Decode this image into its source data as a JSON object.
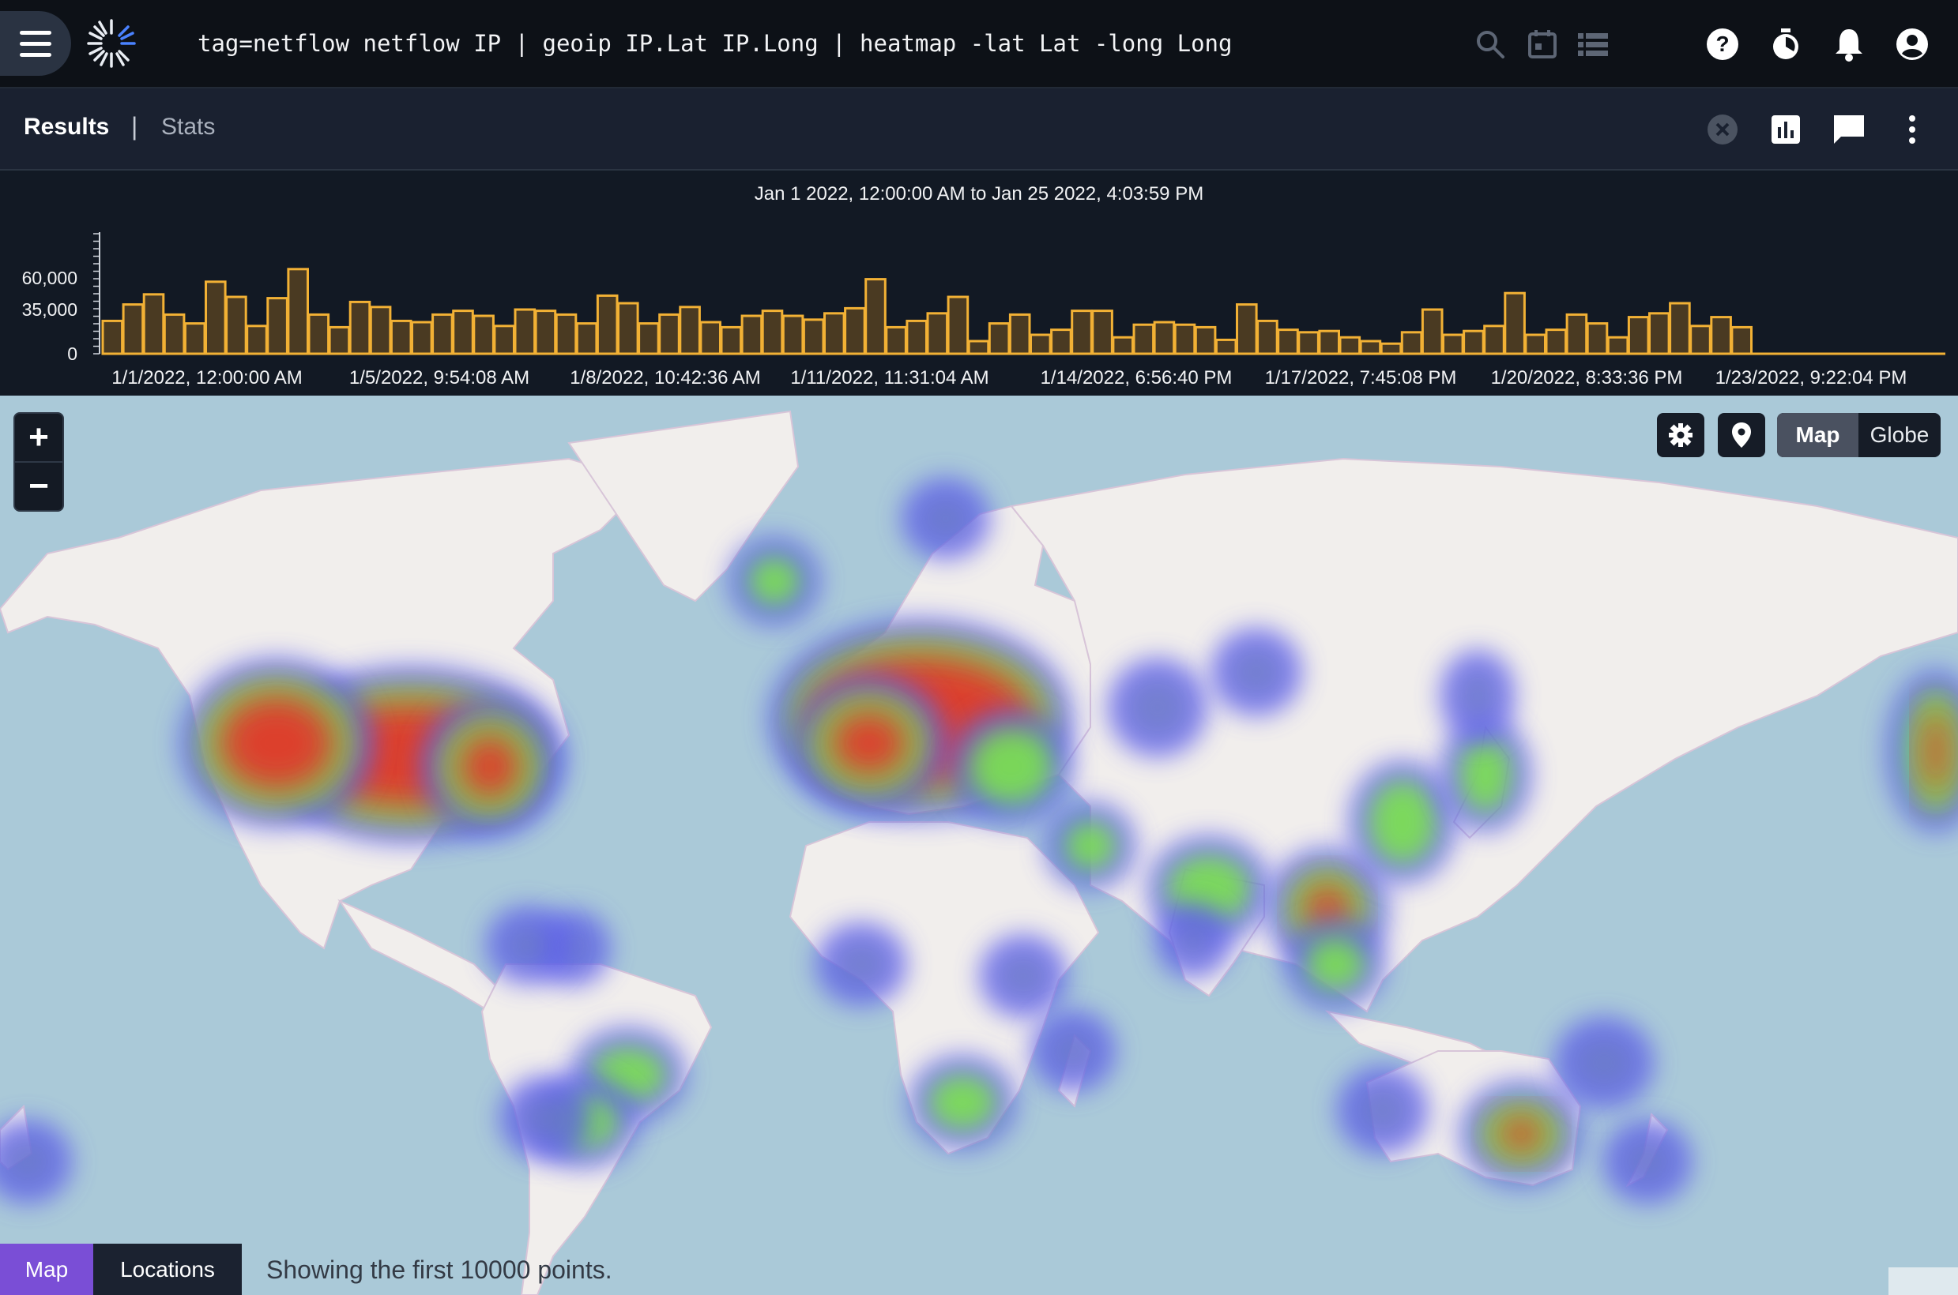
{
  "header": {
    "query": "tag=netflow netflow IP | geoip IP.Lat IP.Long | heatmap -lat Lat -long Long",
    "menu_icon": "hamburger-menu-icon",
    "logo": "gravwell-logo",
    "icons": [
      "search-icon",
      "calendar-icon",
      "list-icon",
      "help-icon",
      "timer-icon",
      "bell-icon",
      "account-icon"
    ]
  },
  "tabs": {
    "results": "Results",
    "separator": "|",
    "stats": "Stats",
    "icons": [
      "close-circle-icon",
      "bar-chart-icon",
      "comment-icon",
      "more-vertical-icon"
    ]
  },
  "timeline": {
    "range_label": "Jan 1 2022, 12:00:00 AM to Jan 25 2022, 4:03:59 PM",
    "bar_color": "#f2b135",
    "bar_fill": "#4a3a22"
  },
  "chart_data": {
    "type": "bar",
    "title": "",
    "xlabel": "",
    "ylabel": "",
    "ylim": [
      0,
      60000
    ],
    "yticks": [
      "60,000",
      "35,000",
      "0"
    ],
    "ytick_values": [
      60000,
      35000,
      0
    ],
    "xtick_labels": [
      "1/1/2022, 12:00:00 AM",
      "1/5/2022, 9:54:08 AM",
      "1/8/2022, 10:42:36 AM",
      "1/11/2022, 11:31:04 AM",
      "1/14/2022, 6:56:40 PM",
      "1/17/2022, 7:45:08 PM",
      "1/20/2022, 8:33:36 PM",
      "1/23/2022, 9:22:04 PM"
    ],
    "values": [
      26000,
      39000,
      47000,
      31000,
      24000,
      57000,
      45000,
      22000,
      44000,
      67000,
      31000,
      21000,
      41000,
      37000,
      26000,
      25000,
      31000,
      34000,
      30000,
      22000,
      35000,
      34000,
      31000,
      24000,
      46000,
      40000,
      24000,
      31000,
      37000,
      25000,
      21000,
      30000,
      34000,
      30000,
      27000,
      32000,
      36000,
      59000,
      21000,
      26000,
      32000,
      45000,
      10000,
      24000,
      31000,
      15000,
      19000,
      34000,
      34000,
      13000,
      23000,
      25000,
      23000,
      21000,
      11000,
      39000,
      26000,
      19000,
      17000,
      18000,
      13000,
      10000,
      8000,
      17000,
      35000,
      15000,
      18000,
      22000,
      48000,
      15000,
      19000,
      31000,
      24000,
      13000,
      29000,
      32000,
      40000,
      22000,
      29000,
      21000
    ]
  },
  "map": {
    "zoom_in": "+",
    "zoom_out": "−",
    "settings_icon": "gear-icon",
    "marker_icon": "map-marker-icon",
    "view_map": "Map",
    "view_globe": "Globe",
    "ocean_color": "#aac9d8",
    "land_color": "#f1eeec",
    "heat_colors": [
      "#5b5cf0",
      "#7be24d",
      "#e2392a"
    ]
  },
  "footer": {
    "tab_map": "Map",
    "tab_locations": "Locations",
    "status": "Showing the first 10000 points."
  }
}
